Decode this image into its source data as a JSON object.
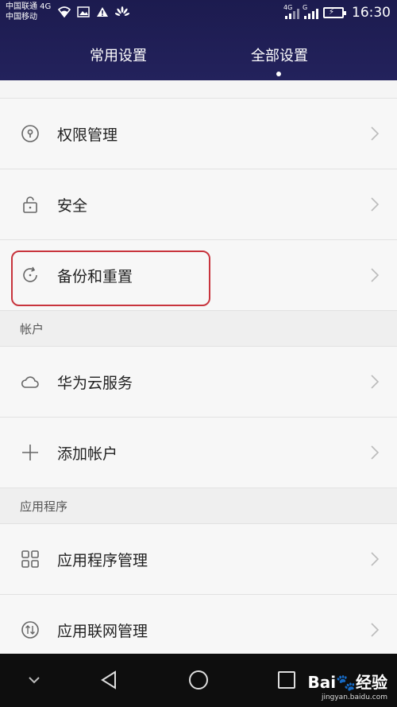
{
  "statusbar": {
    "carrier1": "中国联通 4G",
    "carrier2": "中国移动",
    "net1": "4G",
    "net2": "G",
    "time": "16:30"
  },
  "tabs": {
    "common": "常用设置",
    "all": "全部设置"
  },
  "items_top": [
    {
      "label": "权限管理",
      "icon": "key-lock-icon"
    },
    {
      "label": "安全",
      "icon": "padlock-icon"
    },
    {
      "label": "备份和重置",
      "icon": "refresh-icon"
    }
  ],
  "sections": {
    "account": "帐户",
    "apps": "应用程序"
  },
  "items_account": [
    {
      "label": "华为云服务",
      "icon": "cloud-icon"
    },
    {
      "label": "添加帐户",
      "icon": "plus-icon"
    }
  ],
  "items_apps": [
    {
      "label": "应用程序管理",
      "icon": "grid-icon"
    },
    {
      "label": "应用联网管理",
      "icon": "network-icon"
    }
  ],
  "watermark": {
    "brand": "Bai",
    "brand_suffix": "经验",
    "url": "jingyan.baidu.com"
  },
  "colors": {
    "header": "#1c1b4f",
    "highlight": "#c8343d",
    "navbar": "#0e0e0e"
  }
}
